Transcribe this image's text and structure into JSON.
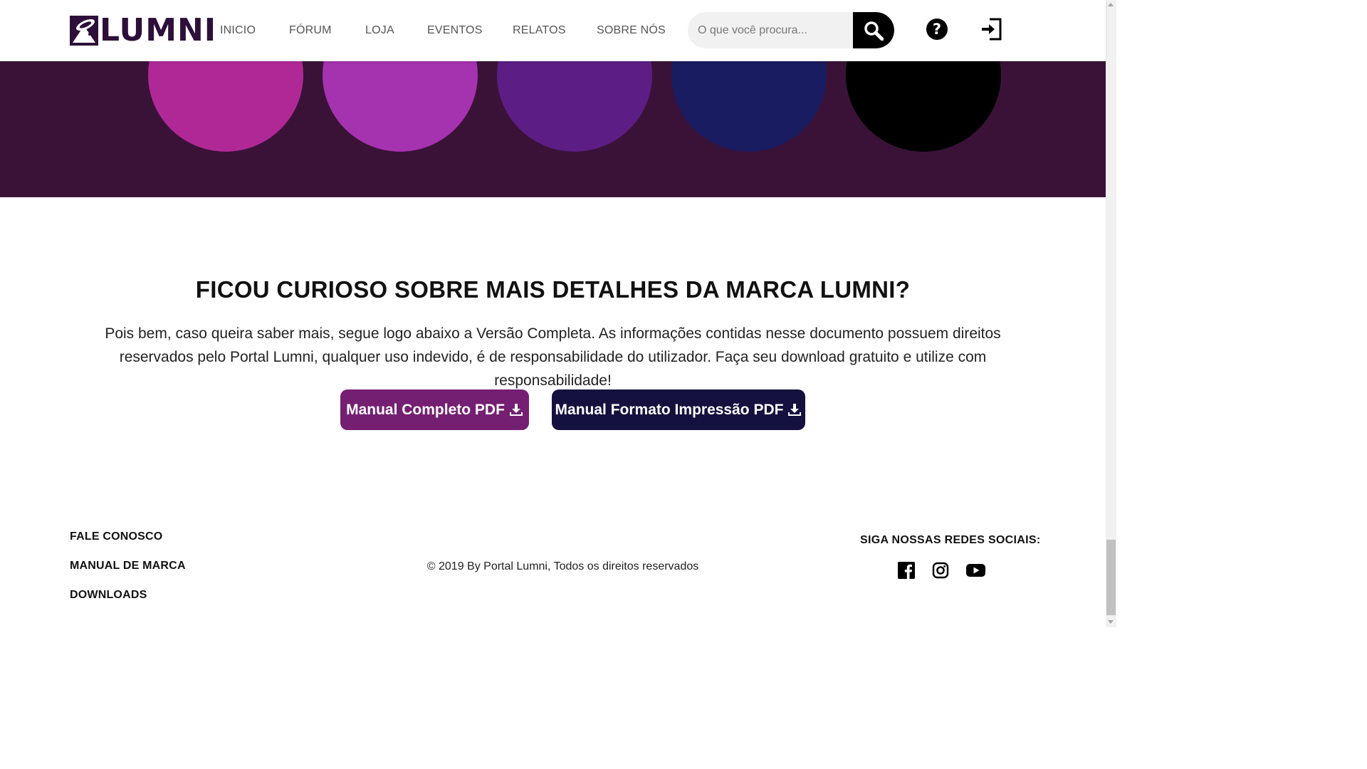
{
  "header": {
    "logo_text": "LUMNI",
    "nav": [
      {
        "label": "INICIO"
      },
      {
        "label": "FÓRUM"
      },
      {
        "label": "LOJA"
      },
      {
        "label": "EVENTOS"
      },
      {
        "label": "RELATOS"
      },
      {
        "label": "SOBRE NÓS"
      }
    ],
    "search": {
      "placeholder": "O que você procura...",
      "value": ""
    },
    "icons": {
      "search": "search-icon",
      "help": "question-circle-icon",
      "login": "sign-in-icon"
    }
  },
  "palette": {
    "background": "#3a1238",
    "swatches": [
      "#b02896",
      "#a532ae",
      "#5c1e84",
      "#1a1c61",
      "#000000"
    ]
  },
  "main": {
    "title": "FICOU CURIOSO SOBRE MAIS DETALHES DA MARCA LUMNI?",
    "text": "Pois bem, caso queira saber mais, segue logo abaixo a Versão Completa. As informações contidas nesse documento possuem direitos reservados pelo Portal Lumni, qualquer uso indevido, é de responsabilidade do utilizador. Faça seu download gratuito e utilize com responsabilidade!",
    "buttons": [
      {
        "label": "Manual Completo PDF",
        "color": "#741f72",
        "icon": "download-icon"
      },
      {
        "label": "Manual Formato Impressão PDF",
        "color": "#14113f",
        "icon": "download-icon"
      }
    ]
  },
  "footer": {
    "links": [
      {
        "label": "FALE CONOSCO"
      },
      {
        "label": "MANUAL DE MARCA"
      },
      {
        "label": "DOWNLOADS"
      }
    ],
    "copyright": "© 2019 By Portal Lumni, Todos os direitos reservados",
    "social_title": "SIGA NOSSAS REDES SOCIAIS:",
    "social": [
      "facebook-icon",
      "instagram-icon",
      "youtube-icon"
    ]
  }
}
